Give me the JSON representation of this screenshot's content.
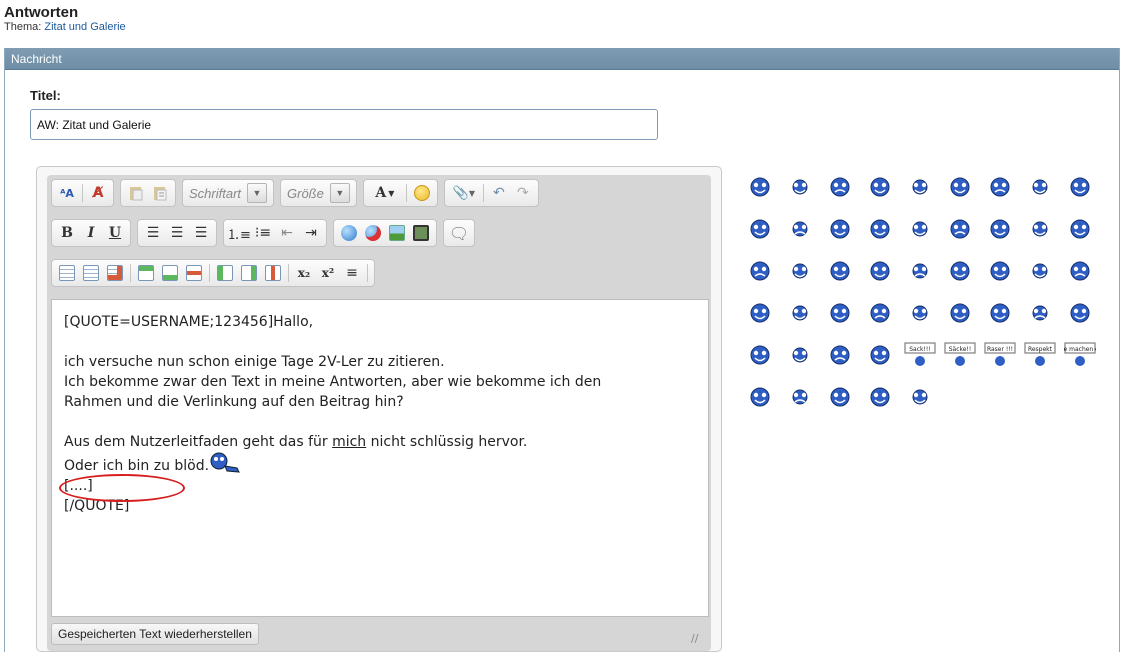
{
  "page": {
    "title": "Antworten",
    "thread_label": "Thema:",
    "thread_link": "Zitat und Galerie"
  },
  "panel": {
    "header": "Nachricht"
  },
  "title_field": {
    "label": "Titel:",
    "value": "AW: Zitat und Galerie"
  },
  "toolbar": {
    "font_select": "Schriftart",
    "size_select": "Größe",
    "font_color_label": "A",
    "bold": "B",
    "italic": "I",
    "underline": "U",
    "subscript": "x₂",
    "superscript": "x²"
  },
  "editor": {
    "lines": [
      "[QUOTE=USERNAME;123456]Hallo,",
      "",
      "ich versuche nun schon einige Tage 2V-Ler zu zitieren.",
      "Ich bekomme zwar den Text in meine Antworten, aber wie bekomme ich den",
      "Rahmen und die Verlinkung auf den Beitrag hin?",
      "",
      "Aus dem Nutzerleitfaden geht das für ",
      "mich",
      " nicht schlüssig hervor.",
      "Oder ich bin zu blöd.",
      "[....]",
      "[/QUOTE]"
    ],
    "restore_label": "Gespeicherten Text wiederherstellen",
    "grip": "//"
  },
  "smilies": {
    "signs": [
      "Sack!!!",
      "Säcke!!",
      "Raser !!!",
      "Respekt",
      "Sie machen es"
    ],
    "rows": 6
  },
  "colors": {
    "panel_header": "#7f9cb3",
    "smiley_blue": "#2f5fc4",
    "highlight_ring": "#d61e1e",
    "link": "#1b5a9a"
  }
}
